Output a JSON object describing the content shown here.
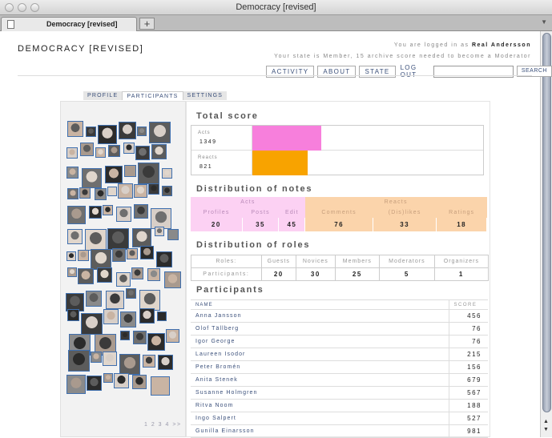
{
  "window": {
    "title": "Democracy [revised]",
    "tab_label": "Democracy [revised]",
    "newtab": "+"
  },
  "site": {
    "logo": "DEMOCRACY [REVISED]",
    "login_prefix": "You are logged in as",
    "login_user": "Real Andersson",
    "state_line": "Your state is Member, 15 archive score needed to become a Moderator"
  },
  "nav": {
    "activity": "ACTIVITY",
    "about": "ABOUT",
    "state": "STATE",
    "logout": "LOG OUT",
    "search_value": "",
    "search_button": "SEARCH"
  },
  "subtabs": [
    "PROFILE",
    "PARTICIPANTS",
    "SETTINGS"
  ],
  "total_score": {
    "title": "Total score",
    "acts_label": "Acts",
    "acts_value": "1349",
    "reacts_label": "Reacts",
    "reacts_value": "821",
    "acts_color": "#f77fdc",
    "reacts_color": "#f8a300",
    "acts_fraction": 0.3,
    "reacts_fraction": 0.24
  },
  "distribution_notes": {
    "title": "Distribution of notes",
    "acts_header": "Acts",
    "reacts_header": "Reacts",
    "columns": [
      "Profiles",
      "Posts",
      "Edit",
      "Comments",
      "(Dis)likes",
      "Ratings"
    ],
    "values": [
      "20",
      "35",
      "45",
      "76",
      "33",
      "18"
    ]
  },
  "distribution_roles": {
    "title": "Distribution of roles",
    "row_label_roles": "Roles:",
    "row_label_participants": "Participants:",
    "columns": [
      "Guests",
      "Novices",
      "Members",
      "Moderators",
      "Organizers"
    ],
    "values": [
      "20",
      "30",
      "25",
      "5",
      "1"
    ]
  },
  "participants": {
    "title": "Participants",
    "name_header": "NAME",
    "score_header": "SCORE",
    "rows": [
      {
        "name": "Anna Jansson",
        "score": "456"
      },
      {
        "name": "Olof Tällberg",
        "score": "76"
      },
      {
        "name": "Igor George",
        "score": "76"
      },
      {
        "name": "Laureen Isodor",
        "score": "215"
      },
      {
        "name": "Peter Bromén",
        "score": "156"
      },
      {
        "name": "Anita Stenek",
        "score": "679"
      },
      {
        "name": "Susanne Holmgren",
        "score": "567"
      },
      {
        "name": "Ritva Noom",
        "score": "188"
      },
      {
        "name": "Ingo Salpert",
        "score": "527"
      },
      {
        "name": "Gunilla Einarsson",
        "score": "981"
      }
    ]
  },
  "pager": "1 2 3 4 >>"
}
